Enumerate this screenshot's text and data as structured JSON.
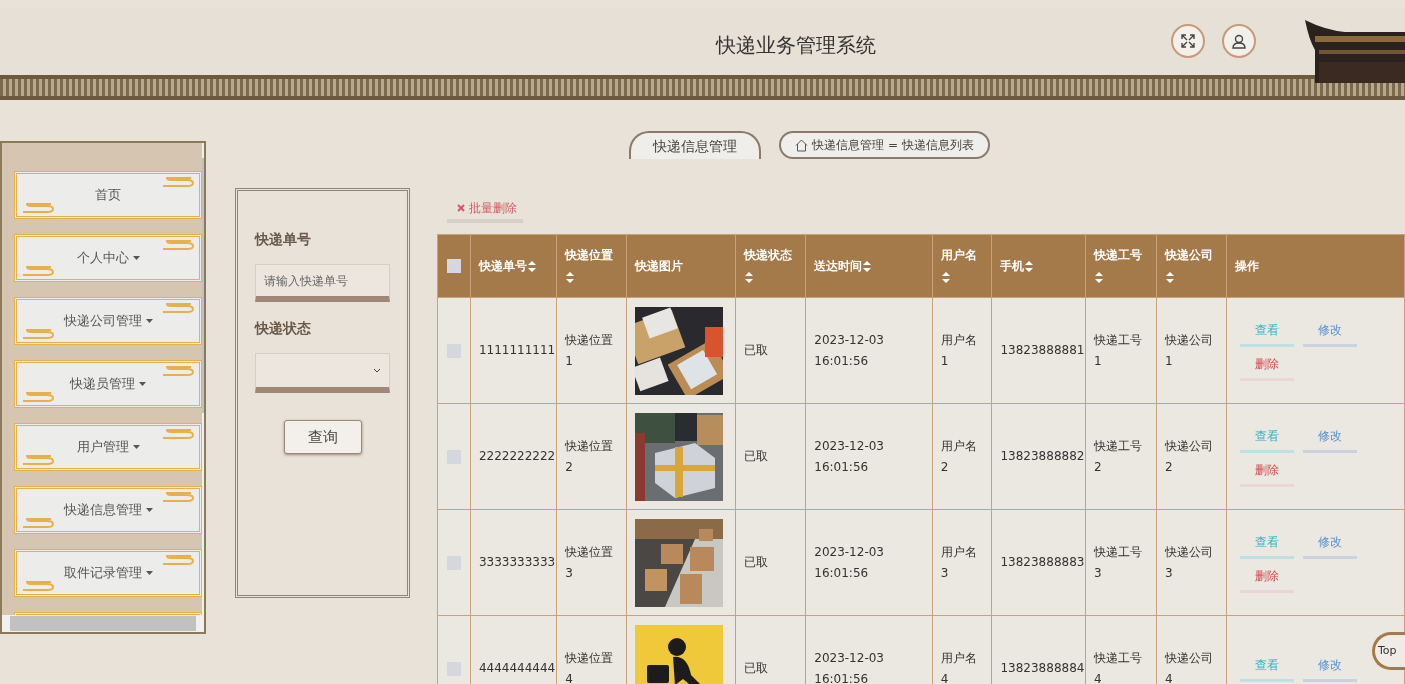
{
  "header": {
    "title": "快递业务管理系统"
  },
  "sidebar": {
    "items": [
      {
        "label": "首页",
        "has_submenu": false
      },
      {
        "label": "个人中心",
        "has_submenu": true
      },
      {
        "label": "快递公司管理",
        "has_submenu": true
      },
      {
        "label": "快递员管理",
        "has_submenu": true
      },
      {
        "label": "用户管理",
        "has_submenu": true
      },
      {
        "label": "快递信息管理",
        "has_submenu": true
      },
      {
        "label": "取件记录管理",
        "has_submenu": true
      }
    ]
  },
  "search": {
    "fields": [
      {
        "label": "快递单号",
        "kind": "text",
        "placeholder": "请输入快递单号"
      },
      {
        "label": "快递状态",
        "kind": "select"
      }
    ],
    "button": "查询"
  },
  "breadcrumb": {
    "tab": "快递信息管理",
    "path": [
      "快递信息管理",
      "快递信息列表"
    ],
    "separator": "="
  },
  "batch_delete": "批量删除",
  "table": {
    "header_checked": false,
    "columns": [
      {
        "label": "快递单号",
        "sortable": true
      },
      {
        "label": "快递位置",
        "sortable": true
      },
      {
        "label": "快递图片",
        "sortable": false
      },
      {
        "label": "快递状态",
        "sortable": true
      },
      {
        "label": "送达时间",
        "sortable": true
      },
      {
        "label": "用户名",
        "sortable": true
      },
      {
        "label": "手机",
        "sortable": true
      },
      {
        "label": "快递工号",
        "sortable": true
      },
      {
        "label": "快递公司",
        "sortable": true
      },
      {
        "label": "操作",
        "sortable": false
      }
    ],
    "rows": [
      {
        "checked": false,
        "number": "1111111111",
        "location": "快递位置1",
        "picture": {
          "kind": "picture"
        },
        "status": "已取",
        "time": "2023-12-03 16:01:56",
        "username": "用户名1",
        "phone": "13823888881",
        "courier_id": "快递工号1",
        "company": "快递公司1",
        "actions": [
          "查看",
          "修改",
          "删除"
        ]
      },
      {
        "checked": false,
        "number": "2222222222",
        "location": "快递位置2",
        "picture": {
          "kind": "picture"
        },
        "status": "已取",
        "time": "2023-12-03 16:01:56",
        "username": "用户名2",
        "phone": "13823888882",
        "courier_id": "快递工号2",
        "company": "快递公司2",
        "actions": [
          "查看",
          "修改",
          "删除"
        ]
      },
      {
        "checked": false,
        "number": "3333333333",
        "location": "快递位置3",
        "picture": {
          "kind": "picture"
        },
        "status": "已取",
        "time": "2023-12-03 16:01:56",
        "username": "用户名3",
        "phone": "13823888883",
        "courier_id": "快递工号3",
        "company": "快递公司3",
        "actions": [
          "查看",
          "修改",
          "删除"
        ]
      },
      {
        "checked": false,
        "number": "4444444444",
        "location": "快递位置4",
        "picture": {
          "kind": "picture"
        },
        "status": "已取",
        "time": "2023-12-03 16:01:56",
        "username": "用户名4",
        "phone": "13823888884",
        "courier_id": "快递工号4",
        "company": "快递公司4",
        "actions": [
          "查看",
          "修改"
        ]
      }
    ]
  },
  "back_to_top": "Top"
}
